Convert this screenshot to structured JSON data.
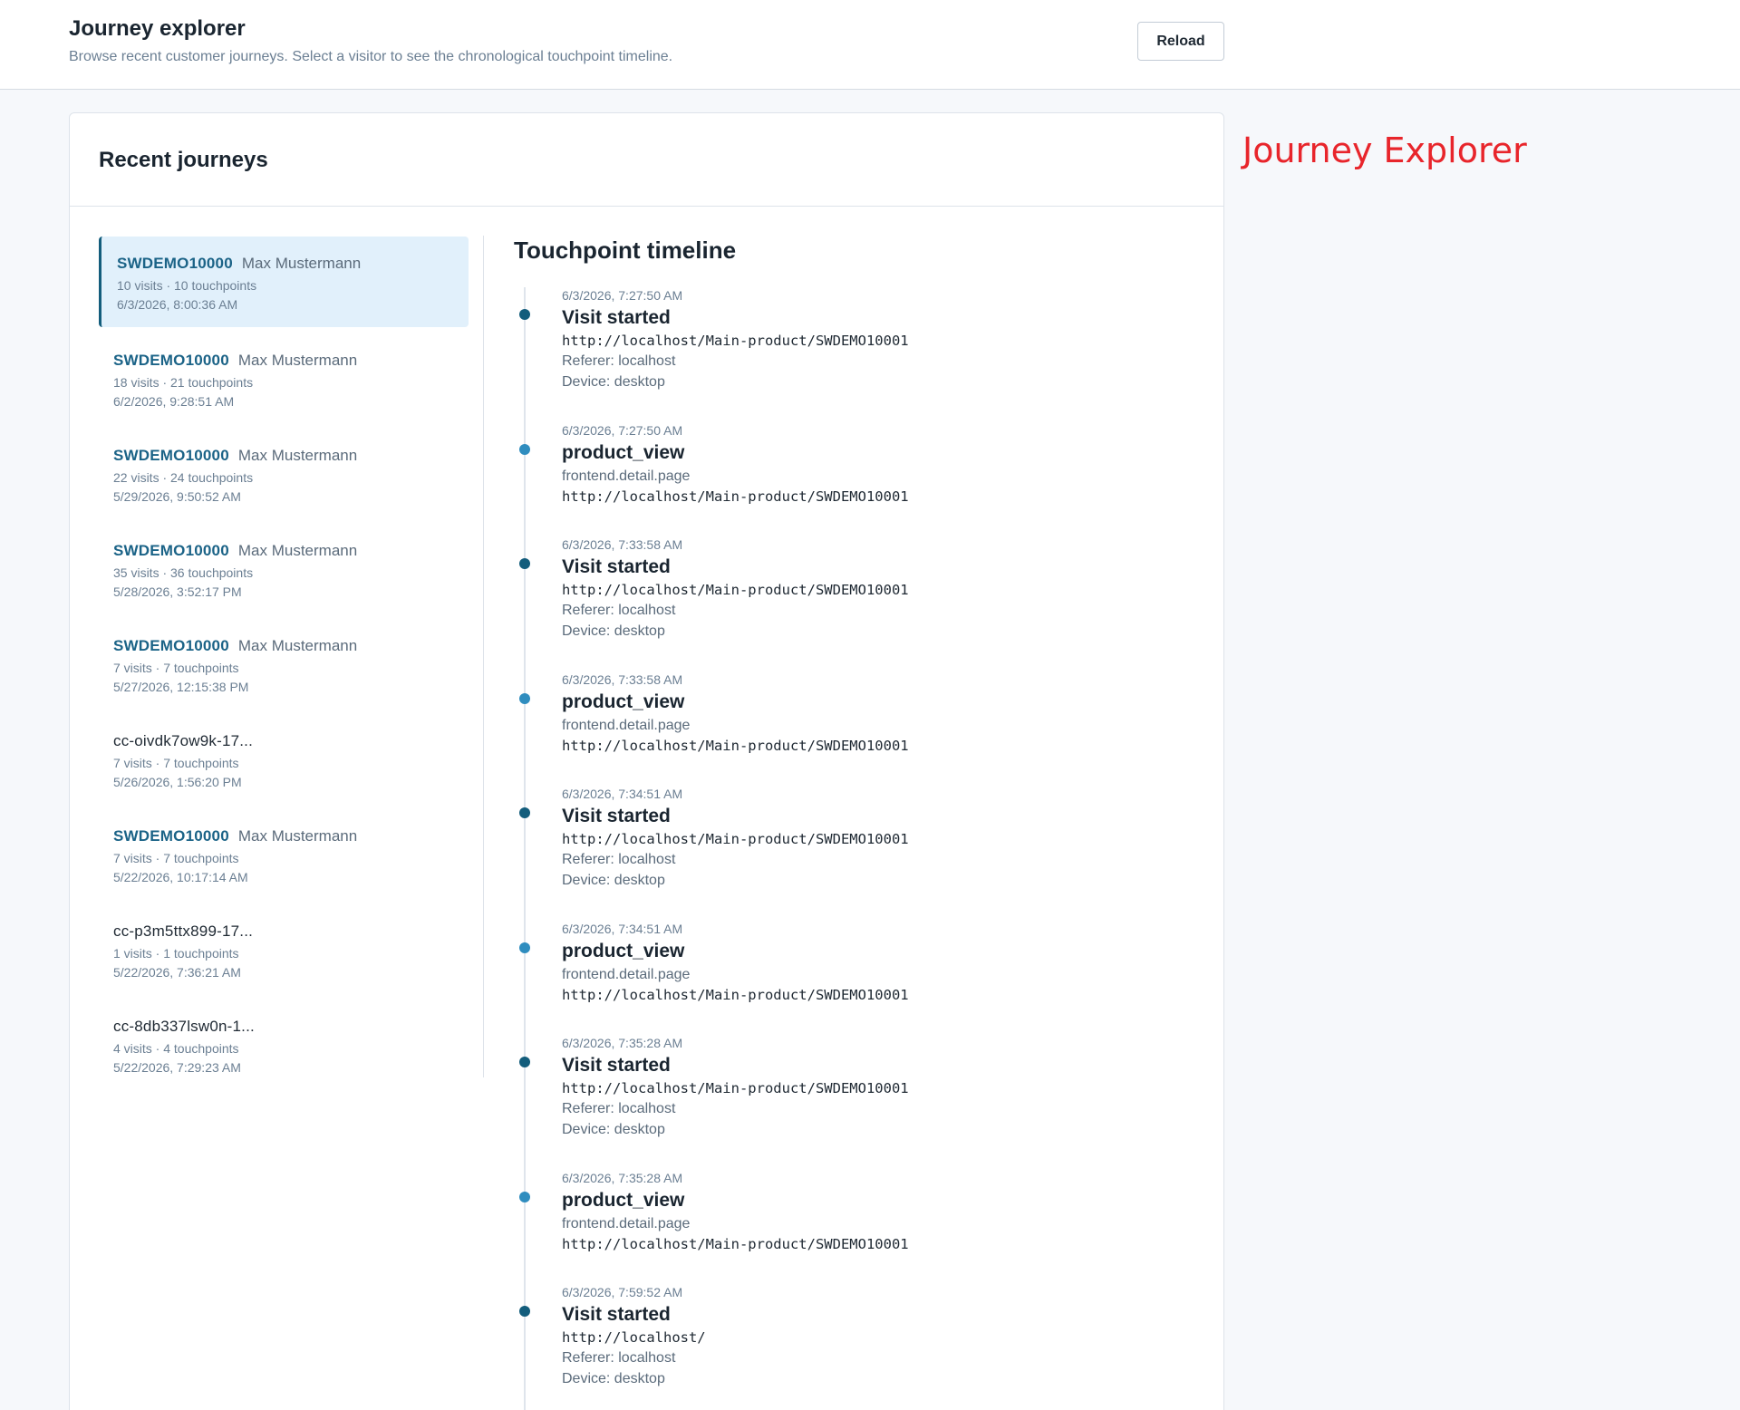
{
  "header": {
    "title": "Journey explorer",
    "subtitle": "Browse recent customer journeys. Select a visitor to see the chronological touchpoint timeline.",
    "reload_label": "Reload"
  },
  "watermark": "Journey Explorer",
  "card": {
    "title": "Recent journeys"
  },
  "journeys": [
    {
      "id": "SWDEMO10000",
      "name": "Max Mustermann",
      "stats": "10 visits · 10 touchpoints",
      "date": "6/3/2026, 8:00:36 AM"
    },
    {
      "id": "SWDEMO10000",
      "name": "Max Mustermann",
      "stats": "18 visits · 21 touchpoints",
      "date": "6/2/2026, 9:28:51 AM"
    },
    {
      "id": "SWDEMO10000",
      "name": "Max Mustermann",
      "stats": "22 visits · 24 touchpoints",
      "date": "5/29/2026, 9:50:52 AM"
    },
    {
      "id": "SWDEMO10000",
      "name": "Max Mustermann",
      "stats": "35 visits · 36 touchpoints",
      "date": "5/28/2026, 3:52:17 PM"
    },
    {
      "id": "SWDEMO10000",
      "name": "Max Mustermann",
      "stats": "7 visits · 7 touchpoints",
      "date": "5/27/2026, 12:15:38 PM"
    },
    {
      "id": "cc-oivdk7ow9k-17...",
      "name": "",
      "stats": "7 visits · 7 touchpoints",
      "date": "5/26/2026, 1:56:20 PM"
    },
    {
      "id": "SWDEMO10000",
      "name": "Max Mustermann",
      "stats": "7 visits · 7 touchpoints",
      "date": "5/22/2026, 10:17:14 AM"
    },
    {
      "id": "cc-p3m5ttx899-17...",
      "name": "",
      "stats": "1 visits · 1 touchpoints",
      "date": "5/22/2026, 7:36:21 AM"
    },
    {
      "id": "cc-8db337lsw0n-1...",
      "name": "",
      "stats": "4 visits · 4 touchpoints",
      "date": "5/22/2026, 7:29:23 AM"
    }
  ],
  "timeline": {
    "title": "Touchpoint timeline",
    "events": [
      {
        "time": "6/3/2026, 7:27:50 AM",
        "label": "Visit started",
        "url": "http://localhost/Main-product/SWDEMO10001",
        "referer": "Referer: localhost",
        "device": "Device: desktop"
      },
      {
        "time": "6/3/2026, 7:27:50 AM",
        "label": "product_view",
        "page": "frontend.detail.page",
        "url": "http://localhost/Main-product/SWDEMO10001"
      },
      {
        "time": "6/3/2026, 7:33:58 AM",
        "label": "Visit started",
        "url": "http://localhost/Main-product/SWDEMO10001",
        "referer": "Referer: localhost",
        "device": "Device: desktop"
      },
      {
        "time": "6/3/2026, 7:33:58 AM",
        "label": "product_view",
        "page": "frontend.detail.page",
        "url": "http://localhost/Main-product/SWDEMO10001"
      },
      {
        "time": "6/3/2026, 7:34:51 AM",
        "label": "Visit started",
        "url": "http://localhost/Main-product/SWDEMO10001",
        "referer": "Referer: localhost",
        "device": "Device: desktop"
      },
      {
        "time": "6/3/2026, 7:34:51 AM",
        "label": "product_view",
        "page": "frontend.detail.page",
        "url": "http://localhost/Main-product/SWDEMO10001"
      },
      {
        "time": "6/3/2026, 7:35:28 AM",
        "label": "Visit started",
        "url": "http://localhost/Main-product/SWDEMO10001",
        "referer": "Referer: localhost",
        "device": "Device: desktop"
      },
      {
        "time": "6/3/2026, 7:35:28 AM",
        "label": "product_view",
        "page": "frontend.detail.page",
        "url": "http://localhost/Main-product/SWDEMO10001"
      },
      {
        "time": "6/3/2026, 7:59:52 AM",
        "label": "Visit started",
        "url": "http://localhost/",
        "referer": "Referer: localhost",
        "device": "Device: desktop"
      }
    ]
  },
  "colors": {
    "accent": "#135d7c",
    "link": "#1b6387",
    "selected_bg": "#e1f0fb",
    "watermark": "#e8252b"
  }
}
